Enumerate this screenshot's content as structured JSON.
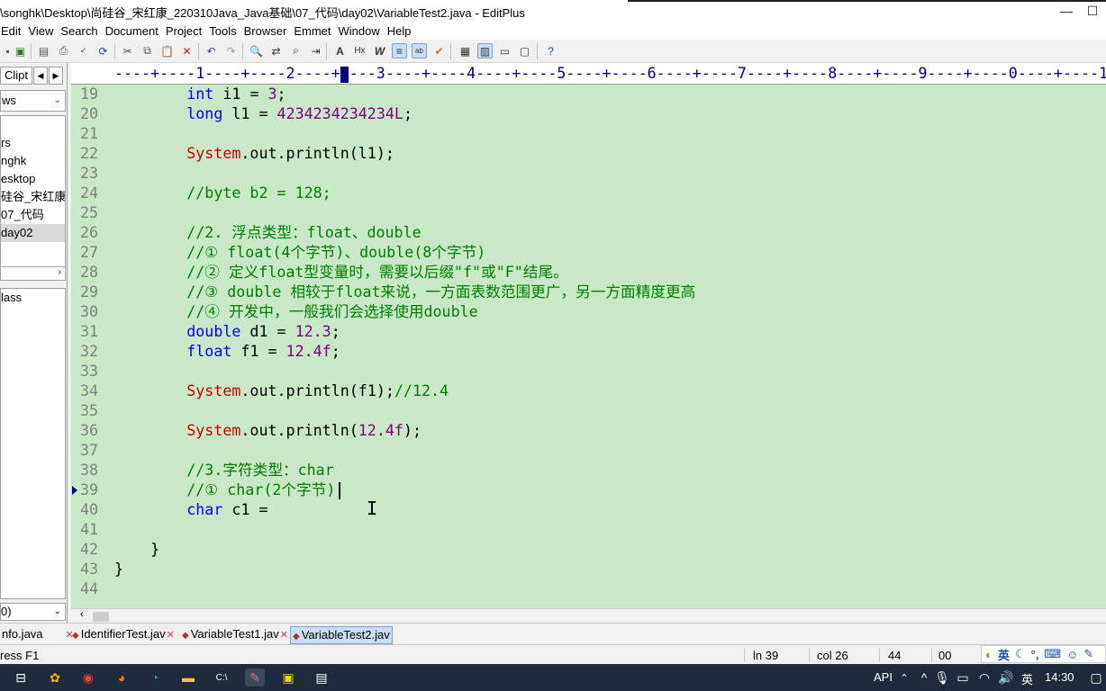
{
  "window": {
    "title": "\\songhk\\Desktop\\尚硅谷_宋红康_220310Java_Java基础\\07_代码\\day02\\VariableTest2.java - EditPlus",
    "minimize": "—",
    "maximize": "☐"
  },
  "menu": [
    "Edit",
    "View",
    "Search",
    "Document",
    "Project",
    "Tools",
    "Browser",
    "Emmet",
    "Window",
    "Help"
  ],
  "left_panel": {
    "tab_label": "Clipt",
    "drive": "ws",
    "folders": [
      "rs",
      "nghk",
      "esktop",
      "硅谷_宋红康_",
      "07_代码",
      "day02"
    ],
    "selected_folder": "day02",
    "files": [
      "lass"
    ],
    "filter": "0)"
  },
  "ruler": "----+----1----+----2----+----3----+----4----+----5----+----6----+----7----+----8----+----9----+----0----+----1",
  "editor": {
    "lines": [
      {
        "n": "19",
        "tokens": [
          {
            "c": "        "
          },
          {
            "k": "int"
          },
          {
            "c": " i1 = "
          },
          {
            "s": "3"
          },
          {
            "c": ";"
          }
        ]
      },
      {
        "n": "20",
        "tokens": [
          {
            "c": "        "
          },
          {
            "k": "long"
          },
          {
            "c": " l1 = "
          },
          {
            "s": "4234234234234L"
          },
          {
            "c": ";"
          }
        ]
      },
      {
        "n": "21",
        "tokens": []
      },
      {
        "n": "22",
        "tokens": [
          {
            "c": "        "
          },
          {
            "r": "System"
          },
          {
            "c": ".out.println(l1);"
          }
        ]
      },
      {
        "n": "23",
        "tokens": []
      },
      {
        "n": "24",
        "tokens": [
          {
            "c": "        "
          },
          {
            "m": "//byte b2 = 128;"
          }
        ]
      },
      {
        "n": "25",
        "tokens": []
      },
      {
        "n": "26",
        "tokens": [
          {
            "c": "        "
          },
          {
            "m": "//2. 浮点类型：float、double"
          }
        ]
      },
      {
        "n": "27",
        "tokens": [
          {
            "c": "        "
          },
          {
            "m": "//① float(4个字节)、double(8个字节)"
          }
        ]
      },
      {
        "n": "28",
        "tokens": [
          {
            "c": "        "
          },
          {
            "m": "//② 定义float型变量时，需要以后缀\"f\"或\"F\"结尾。"
          }
        ]
      },
      {
        "n": "29",
        "tokens": [
          {
            "c": "        "
          },
          {
            "m": "//③ double 相较于float来说，一方面表数范围更广，另一方面精度更高"
          }
        ]
      },
      {
        "n": "30",
        "tokens": [
          {
            "c": "        "
          },
          {
            "m": "//④ 开发中，一般我们会选择使用double"
          }
        ]
      },
      {
        "n": "31",
        "tokens": [
          {
            "c": "        "
          },
          {
            "k": "double"
          },
          {
            "c": " d1 = "
          },
          {
            "s": "12.3"
          },
          {
            "c": ";"
          }
        ]
      },
      {
        "n": "32",
        "tokens": [
          {
            "c": "        "
          },
          {
            "k": "float"
          },
          {
            "c": " f1 = "
          },
          {
            "s": "12.4f"
          },
          {
            "c": ";"
          }
        ]
      },
      {
        "n": "33",
        "tokens": []
      },
      {
        "n": "34",
        "tokens": [
          {
            "c": "        "
          },
          {
            "r": "System"
          },
          {
            "c": ".out.println(f1);"
          },
          {
            "m": "//12.4"
          }
        ]
      },
      {
        "n": "35",
        "tokens": []
      },
      {
        "n": "36",
        "tokens": [
          {
            "c": "        "
          },
          {
            "r": "System"
          },
          {
            "c": ".out.println("
          },
          {
            "s": "12.4f"
          },
          {
            "c": ");"
          }
        ]
      },
      {
        "n": "37",
        "tokens": []
      },
      {
        "n": "38",
        "tokens": [
          {
            "c": "        "
          },
          {
            "m": "//3.字符类型：char"
          }
        ]
      },
      {
        "n": "39",
        "tokens": [
          {
            "c": "        "
          },
          {
            "m": "//① char(2个字节)"
          }
        ]
      },
      {
        "n": "40",
        "tokens": [
          {
            "c": "        "
          },
          {
            "k": "char"
          },
          {
            "c": " c1 ="
          }
        ]
      },
      {
        "n": "41",
        "tokens": []
      },
      {
        "n": "42",
        "tokens": [
          {
            "c": "    }"
          }
        ]
      },
      {
        "n": "43",
        "tokens": [
          {
            "c": "}"
          }
        ]
      },
      {
        "n": "44",
        "tokens": []
      }
    ]
  },
  "doc_tabs": [
    {
      "label": "nfo.java",
      "active": false
    },
    {
      "label": "IdentifierTest.jav",
      "active": false
    },
    {
      "label": "VariableTest1.jav",
      "active": false
    },
    {
      "label": "VariableTest2.jav",
      "active": true
    }
  ],
  "status": {
    "help": "ress F1",
    "line": "ln 39",
    "col": "col 26",
    "num1": "44",
    "num2": "00"
  },
  "ime": {
    "lang": "英"
  },
  "taskbar": {
    "api": "API",
    "input_lang": "英",
    "time": "14:30"
  }
}
